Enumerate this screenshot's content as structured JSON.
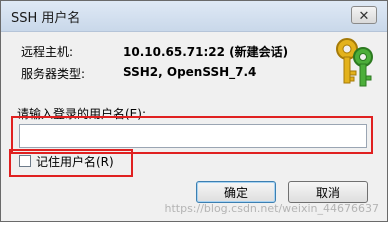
{
  "window": {
    "title": "SSH 用户名",
    "close_glyph": "✕"
  },
  "info": {
    "host_label": "远程主机:",
    "host_value": "10.10.65.71:22 (新建会话)",
    "server_type_label": "服务器类型:",
    "server_type_value": "SSH2, OpenSSH_7.4"
  },
  "prompt": {
    "label": "请输入登录的用户名(E):",
    "value": ""
  },
  "remember": {
    "label": "记住用户名(R)",
    "checked": false
  },
  "buttons": {
    "ok": "确定",
    "cancel": "取消"
  },
  "watermark": "https://blog.csdn.net/weixin_44676637",
  "icons": {
    "key_icon": "keys-icon"
  },
  "colors": {
    "highlight": "#e02020",
    "titlebar": "#c9d8ea"
  }
}
